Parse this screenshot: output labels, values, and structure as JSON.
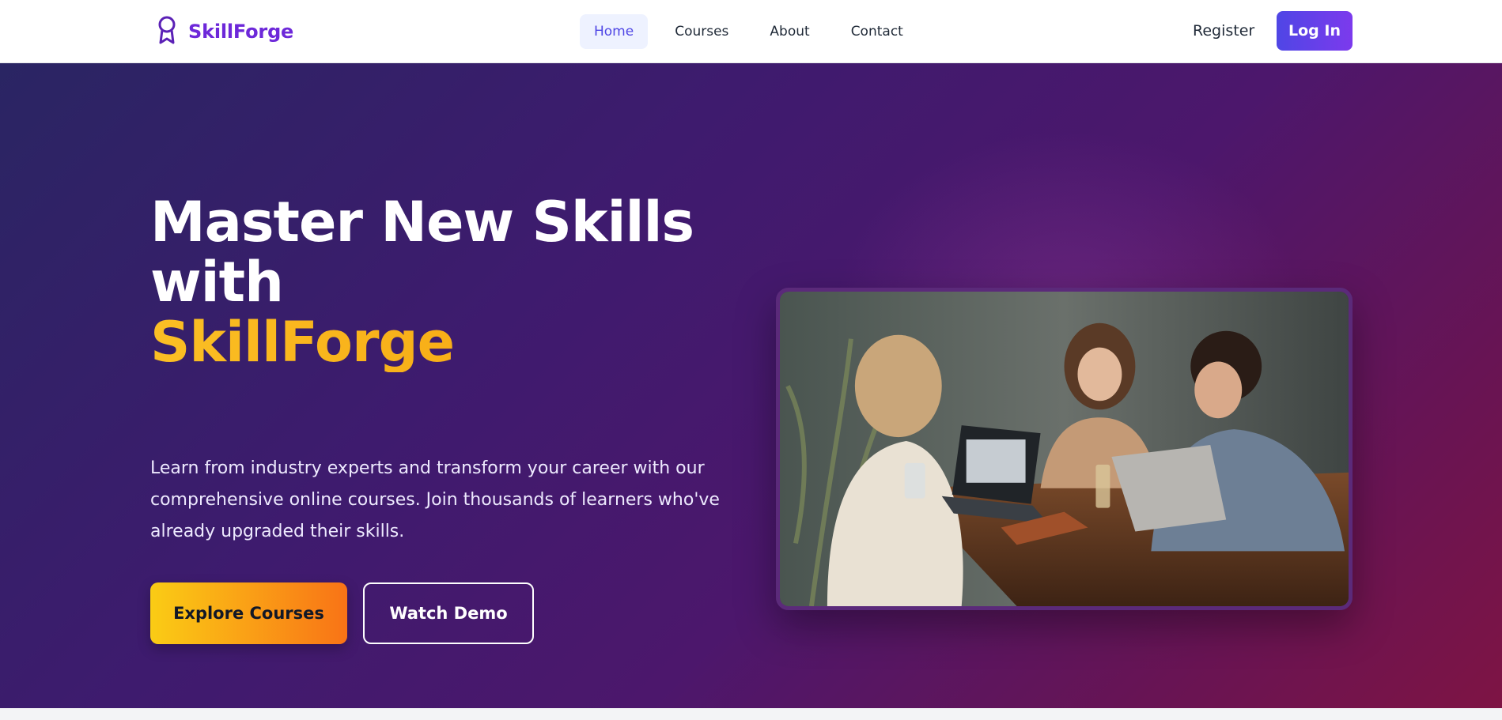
{
  "brand": {
    "name": "SkillForge",
    "icon": "award-ribbon-icon"
  },
  "nav": {
    "links": [
      "Home",
      "Courses",
      "About",
      "Contact"
    ],
    "active": "Home",
    "register_label": "Register",
    "login_label": "Log In"
  },
  "hero": {
    "headline_line1": "Master New Skills",
    "headline_line2": "with",
    "headline_accent": "SkillForge",
    "description": "Learn from industry experts and transform your career with our comprehensive online courses. Join thousands of learners who've already upgraded their skills.",
    "primary_cta": "Explore Courses",
    "secondary_cta": "Watch Demo"
  },
  "colors": {
    "brand": "#6d28d9",
    "accent": "#fbbf24",
    "hero_start": "#2a2563",
    "hero_end": "#7e1444",
    "login_button": "#4f46e5"
  }
}
